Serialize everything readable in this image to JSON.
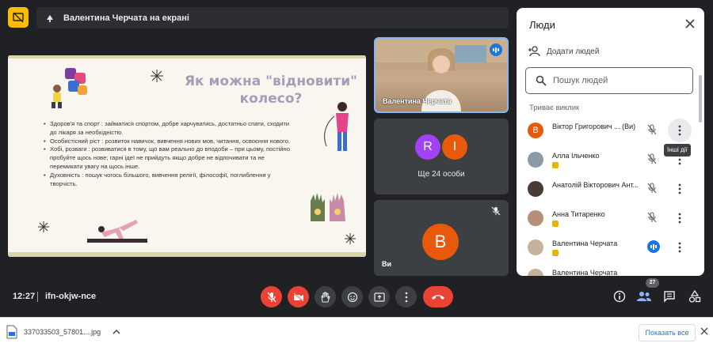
{
  "header": {
    "presenter_title": "Валентина Черчата на екрані",
    "present_icon": "stop-presenting-icon",
    "screen_icon": "present-screen-icon"
  },
  "slide": {
    "title_line1": "Як можна \"відновити\"",
    "title_line2": "колесо?",
    "bullets": [
      "Здоров'я та спорт :  займатися спортом, добре харчуватись, достатньо спати, сходити до лікаря за необхідністю.",
      "Особистісний ріст : розвиток навичок, вивчення нових мов, читання, освоєння нового.",
      "Хобі, розваги : розвиватися в тому, що вам реально до вподоби – при цьому, постійно пробуйте щось нове; гарні ідеї не прийдуть якщо добре не відпочивати та не перемикати увагу на щось інше.",
      "Духовність : пошук чогось більшого, вивчення релігії, філософії, поглиблення у творчість."
    ]
  },
  "tiles": {
    "camera_name": "Валентина Черчата",
    "group_avatars": [
      {
        "letter": "R",
        "color": "#a142f4"
      },
      {
        "letter": "I",
        "color": "#e8590c"
      }
    ],
    "group_label": "Ще 24 особи",
    "you_letter": "B",
    "you_color": "#e8590c",
    "you_name": "Ви"
  },
  "panel": {
    "title": "Люди",
    "add_people": "Додати людей",
    "search_placeholder": "Пошук людей",
    "section_label": "Триває виклик",
    "tooltip": "Інші дії",
    "people": [
      {
        "name": "Віктор Григорович ...",
        "suffix": "(Ви)",
        "avatar_letter": "В",
        "avatar_color": "#e8590c",
        "mic": "muted",
        "badge": false
      },
      {
        "name": "Алла Ільченко",
        "suffix": "",
        "avatar_letter": "",
        "avatar_color": "#8c9aa8",
        "mic": "muted",
        "badge": true
      },
      {
        "name": "Анатолій Вікторович Ант...",
        "suffix": "",
        "avatar_letter": "",
        "avatar_color": "#4a3b35",
        "mic": "muted",
        "badge": false
      },
      {
        "name": "Анна Титаренко",
        "suffix": "",
        "avatar_letter": "",
        "avatar_color": "#b58f78",
        "mic": "muted",
        "badge": true
      },
      {
        "name": "Валентина Черчата",
        "suffix": "",
        "avatar_letter": "",
        "avatar_color": "#c6b29a",
        "mic": "speaking",
        "badge": true
      },
      {
        "name": "Валентина Черчата",
        "suffix": "",
        "avatar_letter": "",
        "avatar_color": "#c6b29a",
        "mic": "muted",
        "badge": false
      }
    ]
  },
  "bottom_bar": {
    "time": "12:27",
    "meeting_code": "ifn-okjw-nce",
    "participants_count": "27"
  },
  "downloads": {
    "file_name": "337033503_57801....jpg",
    "show_all": "Показать все"
  },
  "colors": {
    "accent_blue": "#1a73e8",
    "danger_red": "#ea4335",
    "present_yellow": "#fbbc04"
  }
}
